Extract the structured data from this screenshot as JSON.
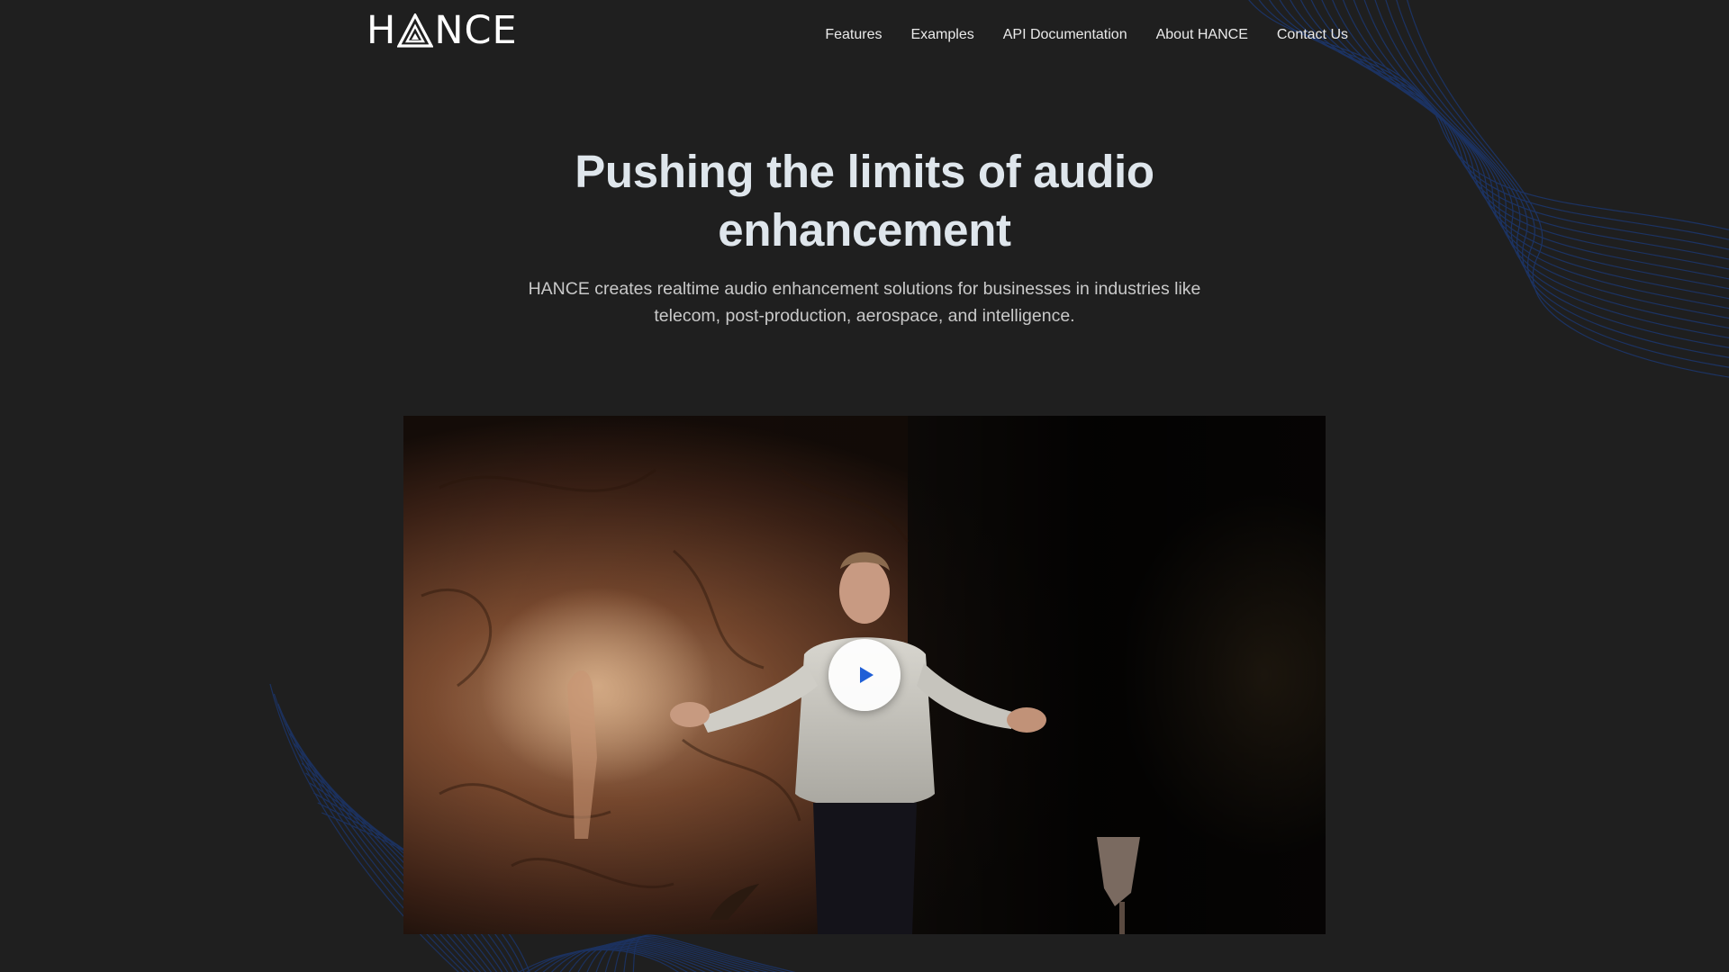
{
  "brand": {
    "logo_text_left": "H",
    "logo_text_right": "NCE",
    "logo_full": "HANCE"
  },
  "nav": {
    "items": [
      {
        "label": "Features"
      },
      {
        "label": "Examples"
      },
      {
        "label": "API Documentation"
      },
      {
        "label": "About HANCE"
      },
      {
        "label": "Contact Us"
      }
    ]
  },
  "hero": {
    "title_line1": "Pushing the limits of audio",
    "title_line2": "enhancement",
    "subtitle_line1": "HANCE creates realtime audio enhancement solutions for businesses in industries like",
    "subtitle_line2": "telecom, post-production, aerospace, and intelligence."
  },
  "video": {
    "play_icon": "play-icon",
    "play_color": "#1f5fd6"
  },
  "colors": {
    "background": "#1f1f1f",
    "wave_accent": "#1b3a7a",
    "title": "#dfe6ec"
  }
}
